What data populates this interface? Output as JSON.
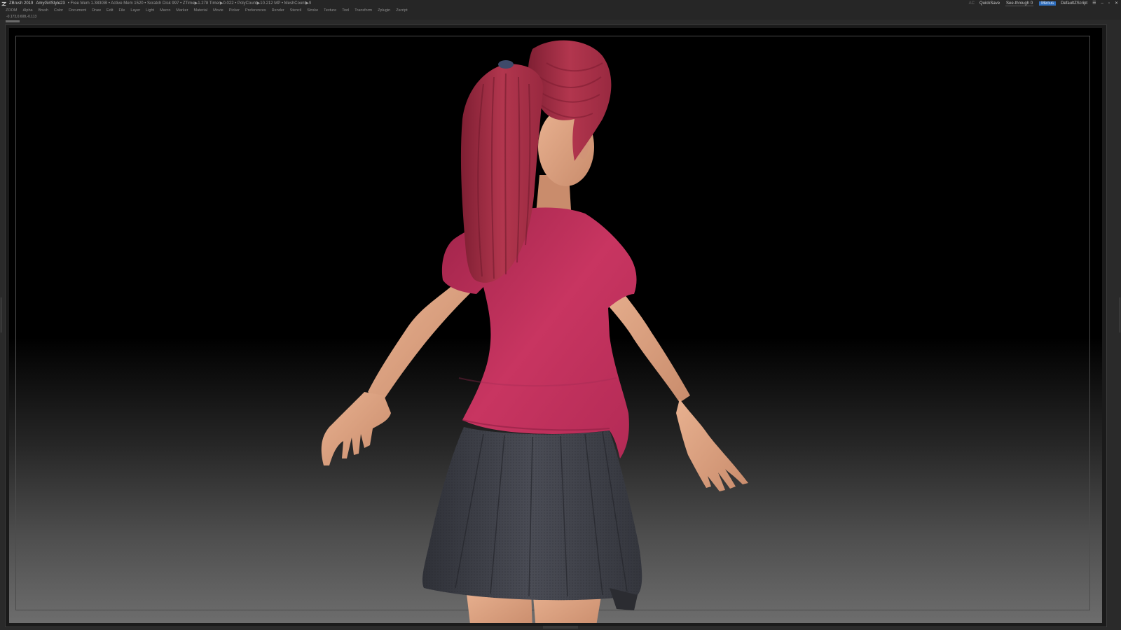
{
  "titlebar": {
    "app": "ZBrush 2019",
    "document": "AmyGirlStyle23",
    "stats": "• Free Mem 1.383GB • Active Mem 1520 • Scratch Disk 997 • ZTime▶1.278 Timer▶0.022 • PolyCount▶10.212 MP • MeshCount▶9",
    "ac": "AC",
    "quicksave": "QuickSave",
    "see_through": "See-through  0",
    "see_through_value": 0,
    "menus_label": "Menus",
    "script": "DefaultZScript"
  },
  "menubar": {
    "items": [
      "ZOOM",
      "Alpha",
      "Brush",
      "Color",
      "Document",
      "Draw",
      "Edit",
      "File",
      "Layer",
      "Light",
      "Macro",
      "Marker",
      "Material",
      "Movie",
      "Picker",
      "Preferences",
      "Render",
      "Stencil",
      "Stroke",
      "Texture",
      "Tool",
      "Transform",
      "Zplugin",
      "Zscript"
    ]
  },
  "coords": "-0.173,0.608,-0.113",
  "colors": {
    "shirt": "#c0305a",
    "hair": "#a82e48",
    "skin": "#e0a27f",
    "skirt": "#3d3f47",
    "accent": "#2f6fbf"
  },
  "icons": [
    "zbrush-logo-icon",
    "window-menu-icon",
    "minimize-icon",
    "maximize-icon",
    "close-icon"
  ]
}
